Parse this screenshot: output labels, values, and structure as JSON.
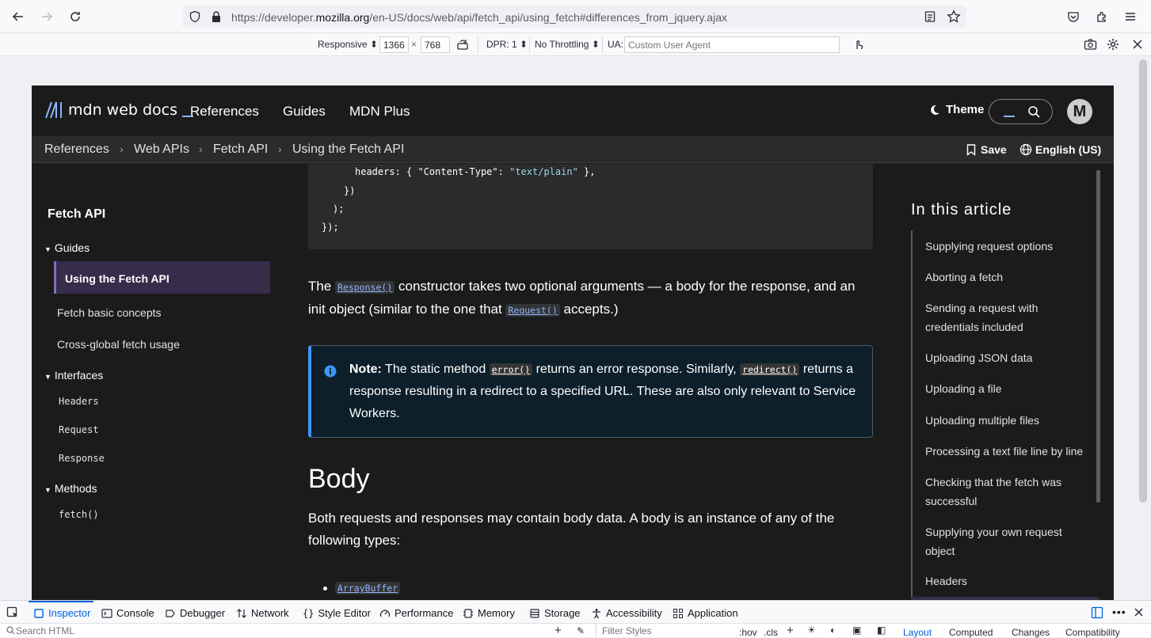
{
  "browser": {
    "url_prefix": "https://developer.",
    "url_domain": "mozilla.org",
    "url_suffix": "/en-US/docs/web/api/fetch_api/using_fetch#differences_from_jquery.ajax"
  },
  "rdm": {
    "device": "Responsive",
    "width": "1366",
    "times": "×",
    "height": "768",
    "dpr": "DPR: 1",
    "throttling": "No Throttling",
    "ua_label": "UA:",
    "ua_placeholder": "Custom User Agent"
  },
  "mdn": {
    "logo_text": "mdn web docs",
    "nav": [
      "References",
      "Guides",
      "MDN Plus"
    ],
    "theme": "Theme",
    "avatar": "M",
    "breadcrumbs": [
      "References",
      "Web APIs",
      "Fetch API",
      "Using the Fetch API"
    ],
    "save": "Save",
    "language": "English (US)"
  },
  "sidebar": {
    "title": "Fetch API",
    "guides_label": "Guides",
    "guides": [
      "Using the Fetch API",
      "Fetch basic concepts",
      "Cross-global fetch usage"
    ],
    "interfaces_label": "Interfaces",
    "interfaces": [
      "Headers",
      "Request",
      "Response"
    ],
    "methods_label": "Methods",
    "methods": [
      "fetch()"
    ]
  },
  "code": {
    "l1_key": "headers: { ",
    "l1_k": "\"Content-Type\"",
    "l1_colon": ": ",
    "l1_v": "\"text/plain\"",
    "l1_end": " },",
    "l2": "})",
    "l3": ");",
    "l4": "});"
  },
  "content": {
    "p1_a": "The ",
    "p1_code1": "Response()",
    "p1_b": " constructor takes two optional arguments — a body for the response, and an init object (similar to the one that ",
    "p1_code2": "Request()",
    "p1_c": " accepts.)",
    "note_label": "Note:",
    "note_a": " The static method ",
    "note_code1": "error()",
    "note_b": " returns an error response. Similarly, ",
    "note_code2": "redirect()",
    "note_c": " returns a response resulting in a redirect to a specified URL. These are also only relevant to Service Workers.",
    "h2": "Body",
    "p2": "Both requests and responses may contain body data. A body is an instance of any of the following types:",
    "list_first": "ArrayBuffer"
  },
  "toc": {
    "title": "In this article",
    "items": [
      "Supplying request options",
      "Aborting a fetch",
      "Sending a request with credentials included",
      "Uploading JSON data",
      "Uploading a file",
      "Uploading multiple files",
      "Processing a text file line by line",
      "Checking that the fetch was successful",
      "Supplying your own request object",
      "Headers"
    ]
  },
  "devtools": {
    "tabs": [
      "Inspector",
      "Console",
      "Debugger",
      "Network",
      "Style Editor",
      "Performance",
      "Memory",
      "Storage",
      "Accessibility",
      "Application"
    ],
    "search_html": "Search HTML",
    "filter_styles": "Filter Styles",
    "hov": ":hov",
    "cls": ".cls",
    "side_tabs": [
      "Layout",
      "Computed",
      "Changes",
      "Compatibility"
    ]
  },
  "colors": {
    "mdn_bg": "#1b1b1b",
    "link": "#8cb4ff",
    "note_accent": "#3d94f7",
    "active_item": "#372c4a",
    "devtools_accent": "#0060df"
  }
}
